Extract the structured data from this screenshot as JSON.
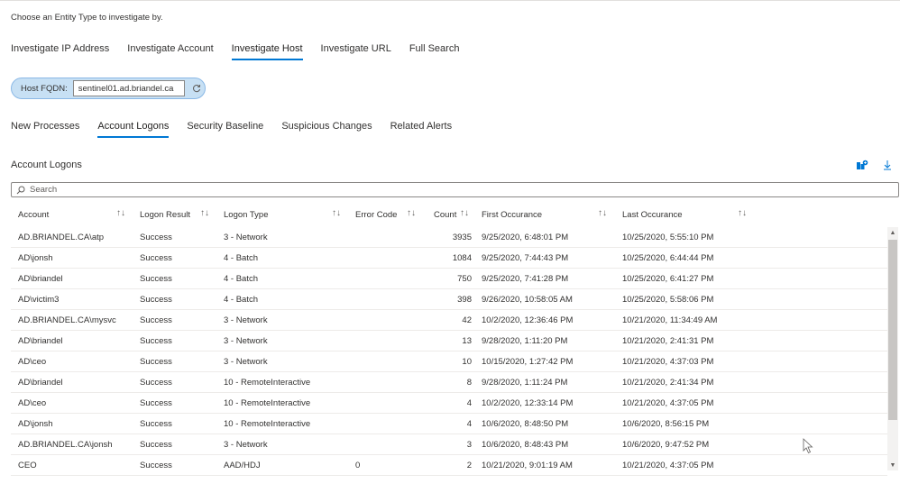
{
  "entity_prompt": "Choose an Entity Type to investigate by.",
  "entity_tabs": [
    {
      "label": "Investigate IP Address",
      "active": false
    },
    {
      "label": "Investigate Account",
      "active": false
    },
    {
      "label": "Investigate Host",
      "active": true
    },
    {
      "label": "Investigate URL",
      "active": false
    },
    {
      "label": "Full Search",
      "active": false
    }
  ],
  "fqdn": {
    "label": "Host FQDN:",
    "value": "sentinel01.ad.briandel.ca"
  },
  "sub_tabs": [
    {
      "label": "New Processes",
      "active": false
    },
    {
      "label": "Account Logons",
      "active": true
    },
    {
      "label": "Security Baseline",
      "active": false
    },
    {
      "label": "Suspicious Changes",
      "active": false
    },
    {
      "label": "Related Alerts",
      "active": false
    }
  ],
  "section_title": "Account Logons",
  "search": {
    "placeholder": "Search"
  },
  "columns": {
    "account": "Account",
    "logon_result": "Logon Result",
    "logon_type": "Logon Type",
    "error_code": "Error Code",
    "count": "Count",
    "first": "First Occurance",
    "last": "Last Occurance",
    "sort_symbol": "↑↓"
  },
  "rows": [
    {
      "account": "AD.BRIANDEL.CA\\atp",
      "result": "Success",
      "type": "3 - Network",
      "error": "",
      "count": "3935",
      "first": "9/25/2020, 6:48:01 PM",
      "last": "10/25/2020, 5:55:10 PM"
    },
    {
      "account": "AD\\jonsh",
      "result": "Success",
      "type": "4 - Batch",
      "error": "",
      "count": "1084",
      "first": "9/25/2020, 7:44:43 PM",
      "last": "10/25/2020, 6:44:44 PM"
    },
    {
      "account": "AD\\briandel",
      "result": "Success",
      "type": "4 - Batch",
      "error": "",
      "count": "750",
      "first": "9/25/2020, 7:41:28 PM",
      "last": "10/25/2020, 6:41:27 PM"
    },
    {
      "account": "AD\\victim3",
      "result": "Success",
      "type": "4 - Batch",
      "error": "",
      "count": "398",
      "first": "9/26/2020, 10:58:05 AM",
      "last": "10/25/2020, 5:58:06 PM"
    },
    {
      "account": "AD.BRIANDEL.CA\\mysvc",
      "result": "Success",
      "type": "3 - Network",
      "error": "",
      "count": "42",
      "first": "10/2/2020, 12:36:46 PM",
      "last": "10/21/2020, 11:34:49 AM"
    },
    {
      "account": "AD\\briandel",
      "result": "Success",
      "type": "3 - Network",
      "error": "",
      "count": "13",
      "first": "9/28/2020, 1:11:20 PM",
      "last": "10/21/2020, 2:41:31 PM"
    },
    {
      "account": "AD\\ceo",
      "result": "Success",
      "type": "3 - Network",
      "error": "",
      "count": "10",
      "first": "10/15/2020, 1:27:42 PM",
      "last": "10/21/2020, 4:37:03 PM"
    },
    {
      "account": "AD\\briandel",
      "result": "Success",
      "type": "10 - RemoteInteractive",
      "error": "",
      "count": "8",
      "first": "9/28/2020, 1:11:24 PM",
      "last": "10/21/2020, 2:41:34 PM"
    },
    {
      "account": "AD\\ceo",
      "result": "Success",
      "type": "10 - RemoteInteractive",
      "error": "",
      "count": "4",
      "first": "10/2/2020, 12:33:14 PM",
      "last": "10/21/2020, 4:37:05 PM"
    },
    {
      "account": "AD\\jonsh",
      "result": "Success",
      "type": "10 - RemoteInteractive",
      "error": "",
      "count": "4",
      "first": "10/6/2020, 8:48:50 PM",
      "last": "10/6/2020, 8:56:15 PM"
    },
    {
      "account": "AD.BRIANDEL.CA\\jonsh",
      "result": "Success",
      "type": "3 - Network",
      "error": "",
      "count": "3",
      "first": "10/6/2020, 8:48:43 PM",
      "last": "10/6/2020, 9:47:52 PM"
    },
    {
      "account": "CEO",
      "result": "Success",
      "type": "AAD/HDJ",
      "error": "0",
      "count": "2",
      "first": "10/21/2020, 9:01:19 AM",
      "last": "10/21/2020, 4:37:05 PM"
    }
  ],
  "colors": {
    "accent": "#0078d4",
    "pill_bg": "#c7e0f4"
  }
}
